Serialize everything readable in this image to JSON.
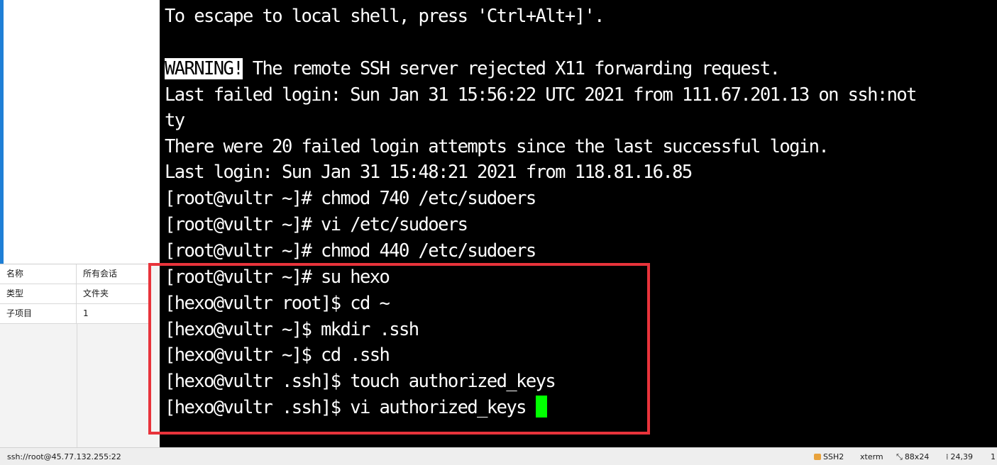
{
  "session_props": [
    {
      "key": "名称",
      "value": "所有会话"
    },
    {
      "key": "类型",
      "value": "文件夹"
    },
    {
      "key": "子项目",
      "value": "1"
    }
  ],
  "terminal": {
    "lines": [
      "To escape to local shell, press 'Ctrl+Alt+]'.",
      "",
      {
        "highlight": "WARNING!",
        "rest": " The remote SSH server rejected X11 forwarding request."
      },
      "Last failed login: Sun Jan 31 15:56:22 UTC 2021 from 111.67.201.13 on ssh:not",
      "ty",
      "There were 20 failed login attempts since the last successful login.",
      "Last login: Sun Jan 31 15:48:21 2021 from 118.81.16.85",
      "[root@vultr ~]# chmod 740 /etc/sudoers",
      "[root@vultr ~]# vi /etc/sudoers",
      "[root@vultr ~]# chmod 440 /etc/sudoers",
      "[root@vultr ~]# su hexo",
      "[hexo@vultr root]$ cd ~",
      "[hexo@vultr ~]$ mkdir .ssh",
      "[hexo@vultr ~]$ cd .ssh",
      "[hexo@vultr .ssh]$ touch authorized_keys",
      "[hexo@vultr .ssh]$ vi authorized_keys "
    ],
    "cursor_color": "#00ff00",
    "highlight_box_color": "#e8333b"
  },
  "status_bar": {
    "connection": "ssh://root@45.77.132.255:22",
    "protocol": "SSH2",
    "terminal_type": "xterm",
    "size": "88x24",
    "cursor_pos": "24,39",
    "extra": "1",
    "lock_icon": "lock-icon",
    "size_icon": "resize-icon",
    "pos_icon": "cursor-position-icon"
  }
}
